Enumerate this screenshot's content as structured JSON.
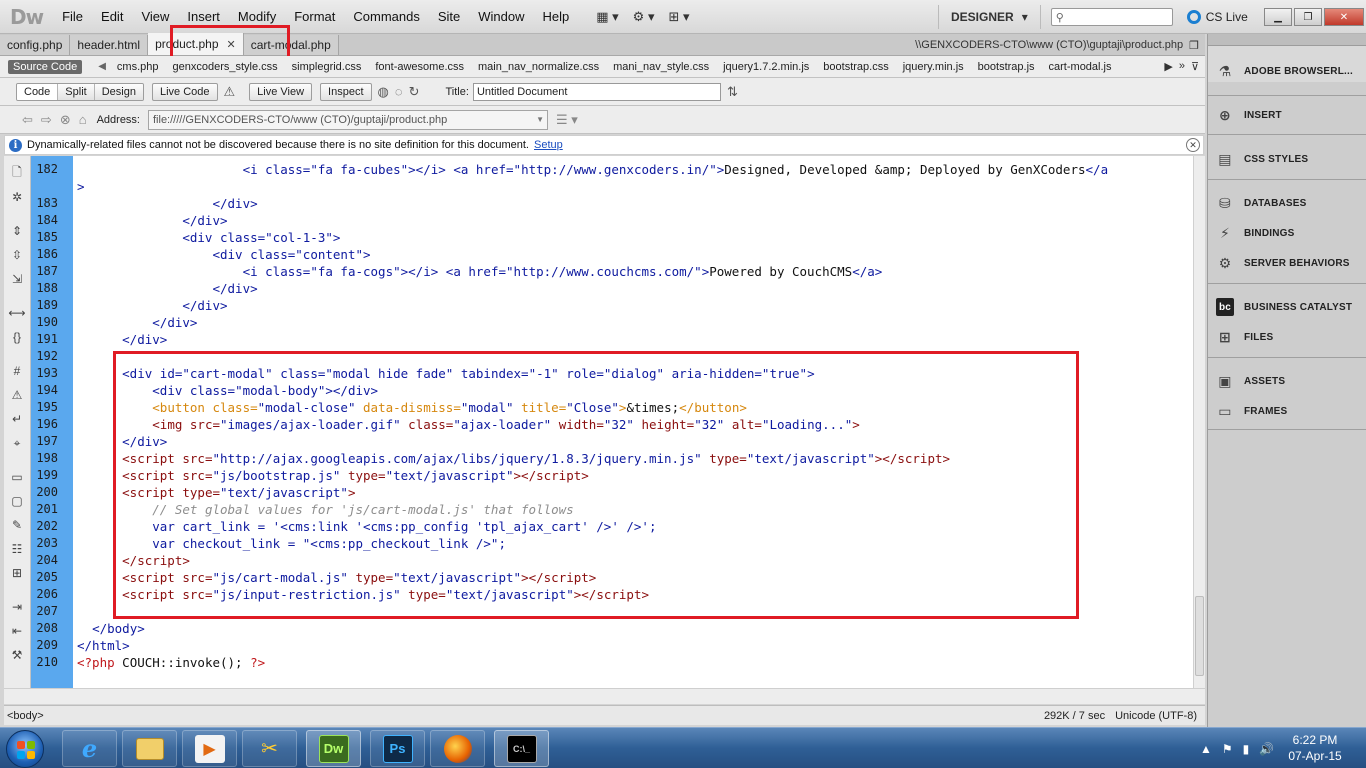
{
  "app": {
    "logo": "Dw",
    "menus": [
      "File",
      "Edit",
      "View",
      "Insert",
      "Modify",
      "Format",
      "Commands",
      "Site",
      "Window",
      "Help"
    ],
    "workspace": "DESIGNER",
    "search_placeholder": "",
    "cs_live": "CS Live"
  },
  "doc_tabs": [
    {
      "label": "config.php"
    },
    {
      "label": "header.html"
    },
    {
      "label": "product.php"
    },
    {
      "label": "cart-modal.php"
    }
  ],
  "doc_path": "\\\\GENXCODERS-CTO\\www (CTO)\\guptaji\\product.php",
  "related": {
    "source_code": "Source Code",
    "files": [
      "cms.php",
      "genxcoders_style.css",
      "simplegrid.css",
      "font-awesome.css",
      "main_nav_normalize.css",
      "mani_nav_style.css",
      "jquery1.7.2.min.js",
      "bootstrap.css",
      "jquery.min.js",
      "bootstrap.js",
      "cart-modal.js"
    ]
  },
  "doc_toolbar": {
    "code": "Code",
    "split": "Split",
    "design": "Design",
    "live_code": "Live Code",
    "live_view": "Live View",
    "inspect": "Inspect",
    "title_label": "Title:",
    "title_value": "Untitled Document"
  },
  "address": {
    "label": "Address:",
    "value": "file://///GENXCODERS-CTO/www (CTO)/guptaji/product.php"
  },
  "info": {
    "message": "Dynamically-related files cannot not be discovered because there is no site definition for this document.",
    "link": "Setup"
  },
  "code_lines": [
    {
      "n": "182",
      "html": "                      <span class=\"tag\">&lt;i </span><span class=\"attr\">class=</span><span class=\"val\">\"fa fa-cubes\"</span><span class=\"tag\">&gt;&lt;/i&gt;</span> <span class=\"tag\">&lt;a </span><span class=\"attr\">href=</span><span class=\"val\">\"http://www.genxcoders.in/\"</span><span class=\"tag\">&gt;</span><span class=\"txtblack\">Designed, Developed &amp;amp; Deployed by GenXCoders</span><span class=\"tag\">&lt;/a</span>"
    },
    {
      "n": "",
      "html": "<span class=\"tag\">&gt;</span>"
    },
    {
      "n": "183",
      "html": "                  <span class=\"tag\">&lt;/div&gt;</span>"
    },
    {
      "n": "184",
      "html": "              <span class=\"tag\">&lt;/div&gt;</span>"
    },
    {
      "n": "185",
      "html": "              <span class=\"tag\">&lt;div </span><span class=\"attr\">class=</span><span class=\"val\">\"col-1-3\"</span><span class=\"tag\">&gt;</span>"
    },
    {
      "n": "186",
      "html": "                  <span class=\"tag\">&lt;div </span><span class=\"attr\">class=</span><span class=\"val\">\"content\"</span><span class=\"tag\">&gt;</span>"
    },
    {
      "n": "187",
      "html": "                      <span class=\"tag\">&lt;i </span><span class=\"attr\">class=</span><span class=\"val\">\"fa fa-cogs\"</span><span class=\"tag\">&gt;&lt;/i&gt;</span> <span class=\"tag\">&lt;a </span><span class=\"attr\">href=</span><span class=\"val\">\"http://www.couchcms.com/\"</span><span class=\"tag\">&gt;</span><span class=\"txtblack\">Powered by CouchCMS</span><span class=\"tag\">&lt;/a&gt;</span>"
    },
    {
      "n": "188",
      "html": "                  <span class=\"tag\">&lt;/div&gt;</span>"
    },
    {
      "n": "189",
      "html": "              <span class=\"tag\">&lt;/div&gt;</span>"
    },
    {
      "n": "190",
      "html": "          <span class=\"tag\">&lt;/div&gt;</span>"
    },
    {
      "n": "191",
      "html": "      <span class=\"tag\">&lt;/div&gt;</span>"
    },
    {
      "n": "192",
      "html": ""
    },
    {
      "n": "193",
      "html": "      <span class=\"tag\">&lt;div </span><span class=\"attr\">id=</span><span class=\"val\">\"cart-modal\"</span> <span class=\"attr\">class=</span><span class=\"val\">\"modal hide fade\"</span> <span class=\"attr\">tabindex=</span><span class=\"val\">\"-1\"</span> <span class=\"attr\">role=</span><span class=\"val\">\"dialog\"</span> <span class=\"attr\">aria-hidden=</span><span class=\"val\">\"true\"</span><span class=\"tag\">&gt;</span>"
    },
    {
      "n": "194",
      "html": "          <span class=\"tag\">&lt;div </span><span class=\"attr\">class=</span><span class=\"val\">\"modal-body\"</span><span class=\"tag\">&gt;&lt;/div&gt;</span>"
    },
    {
      "n": "195",
      "html": "          <span class=\"orange\">&lt;button </span><span class=\"orange\">class=</span><span class=\"val\">\"modal-close\"</span> <span class=\"orange\">data-dismiss=</span><span class=\"val\">\"modal\"</span> <span class=\"orange\">title=</span><span class=\"val\">\"Close\"</span><span class=\"orange\">&gt;</span><span class=\"txtblack\">&amp;times;</span><span class=\"orange\">&lt;/button&gt;</span>"
    },
    {
      "n": "196",
      "html": "          <span class=\"scr\">&lt;img </span><span class=\"scr\">src=</span><span class=\"val\">\"images/ajax-loader.gif\"</span> <span class=\"scr\">class=</span><span class=\"val\">\"ajax-loader\"</span> <span class=\"scr\">width=</span><span class=\"val\">\"32\"</span> <span class=\"scr\">height=</span><span class=\"val\">\"32\"</span> <span class=\"scr\">alt=</span><span class=\"val\">\"Loading...\"</span><span class=\"scr\">&gt;</span>"
    },
    {
      "n": "197",
      "html": "      <span class=\"tag\">&lt;/div&gt;</span>"
    },
    {
      "n": "198",
      "html": "      <span class=\"scr\">&lt;script </span><span class=\"scr\">src=</span><span class=\"val\">\"http://ajax.googleapis.com/ajax/libs/jquery/1.8.3/jquery.min.js\"</span> <span class=\"scr\">type=</span><span class=\"val\">\"text/javascript\"</span><span class=\"scr\">&gt;&lt;/script&gt;</span>"
    },
    {
      "n": "199",
      "html": "      <span class=\"scr\">&lt;script </span><span class=\"scr\">src=</span><span class=\"val\">\"js/bootstrap.js\"</span> <span class=\"scr\">type=</span><span class=\"val\">\"text/javascript\"</span><span class=\"scr\">&gt;&lt;/script&gt;</span>"
    },
    {
      "n": "200",
      "html": "      <span class=\"scr\">&lt;script </span><span class=\"scr\">type=</span><span class=\"val\">\"text/javascript\"</span><span class=\"scr\">&gt;</span>"
    },
    {
      "n": "201",
      "html": "          <span class=\"cmt\">// Set global values for 'js/cart-modal.js' that follows</span>"
    },
    {
      "n": "202",
      "html": "          <span class=\"js\">var cart_link = '&lt;cms:link '&lt;cms:pp_config 'tpl_ajax_cart' /&gt;' /&gt;';</span>"
    },
    {
      "n": "203",
      "html": "          <span class=\"js\">var checkout_link = \"&lt;cms:pp_checkout_link /&gt;\";</span>"
    },
    {
      "n": "204",
      "html": "      <span class=\"scr\">&lt;/script&gt;</span>"
    },
    {
      "n": "205",
      "html": "      <span class=\"scr\">&lt;script </span><span class=\"scr\">src=</span><span class=\"val\">\"js/cart-modal.js\"</span> <span class=\"scr\">type=</span><span class=\"val\">\"text/javascript\"</span><span class=\"scr\">&gt;&lt;/script&gt;</span>"
    },
    {
      "n": "206",
      "html": "      <span class=\"scr\">&lt;script </span><span class=\"scr\">src=</span><span class=\"val\">\"js/input-restriction.js\"</span> <span class=\"scr\">type=</span><span class=\"val\">\"text/javascript\"</span><span class=\"scr\">&gt;&lt;/script&gt;</span>"
    },
    {
      "n": "207",
      "html": ""
    },
    {
      "n": "208",
      "html": "  <span class=\"tag\">&lt;/body&gt;</span>"
    },
    {
      "n": "209",
      "html": "<span class=\"tag\">&lt;/html&gt;</span>"
    },
    {
      "n": "210",
      "html": "<span class=\"php\">&lt;?php</span> <span class=\"txtblack\">COUCH::invoke(); </span><span class=\"php\">?&gt;</span>"
    }
  ],
  "status": {
    "tag": "<body>",
    "size": "292K / 7 sec",
    "encoding": "Unicode (UTF-8)"
  },
  "panels": [
    {
      "label": "ADOBE BROWSERL...",
      "icon": "browserlab-icon"
    },
    {
      "label": "INSERT",
      "icon": "insert-icon"
    },
    {
      "label": "CSS STYLES",
      "icon": "css-styles-icon"
    },
    {
      "label": "DATABASES",
      "icon": "databases-icon"
    },
    {
      "label": "BINDINGS",
      "icon": "bindings-icon"
    },
    {
      "label": "SERVER BEHAVIORS",
      "icon": "server-behaviors-icon"
    },
    {
      "label": "BUSINESS CATALYST",
      "icon": "business-catalyst-icon"
    },
    {
      "label": "FILES",
      "icon": "files-icon"
    },
    {
      "label": "ASSETS",
      "icon": "assets-icon"
    },
    {
      "label": "FRAMES",
      "icon": "frames-icon"
    }
  ],
  "taskbar": {
    "apps": [
      "Internet Explorer",
      "Windows Explorer",
      "Media Player",
      "Tools",
      "Dreamweaver",
      "Photoshop",
      "Firefox",
      "Command Prompt"
    ],
    "dw_label": "Dw",
    "ps_label": "Ps",
    "time": "6:22 PM",
    "date": "07-Apr-15"
  }
}
